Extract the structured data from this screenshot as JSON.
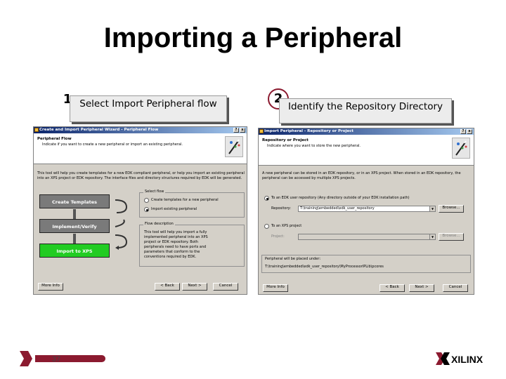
{
  "slide": {
    "title": "Importing a Peripheral",
    "page_number": "37",
    "logo_text": "XILINX",
    "brand_color": "#8b1a2f"
  },
  "steps": [
    {
      "number": "1",
      "label": "Select Import Peripheral flow"
    },
    {
      "number": "2",
      "label": "Identify the Repository Directory"
    }
  ],
  "window1": {
    "title": "Create and Import Peripheral Wizard - Peripheral Flow",
    "help_btn": "?",
    "close_btn": "x",
    "header_title": "Peripheral Flow",
    "header_subtitle": "Indicate if you want to create a new peripheral or import an existing peripheral.",
    "intro": "This tool will help you create templates for a new EDK compliant peripheral, or help you import an existing peripheral into an XPS project or EDK repository. The interface files and directory structures required by EDK will be generated.",
    "flow_boxes": [
      "Create Templates",
      "Implement/Verify",
      "Import to XPS"
    ],
    "select_flow_legend": "Select flow",
    "option_create": "Create templates for a new peripheral",
    "option_import": "Import existing peripheral",
    "flow_desc_legend": "Flow description",
    "flow_description": "This tool will help you import a fully implemented peripheral into an XPS project or EDK repository. Both peripherals need to have ports and parameters that conform to the conventions required by EDK.",
    "buttons": {
      "more_info": "More Info",
      "back": "< Back",
      "next": "Next >",
      "cancel": "Cancel"
    }
  },
  "window2": {
    "title": "Import Peripheral - Repository or Project",
    "help_btn": "?",
    "close_btn": "x",
    "header_title": "Repository or Project",
    "header_subtitle": "Indicate where you want to store the new peripheral.",
    "intro": "A new peripheral can be stored in an EDK repository, or in an XPS project. When stored in an EDK repository, the peripheral can be accessed by multiple XPS projects.",
    "option_repo": "To an EDK user repository (Any directory outside of your EDK installation path)",
    "repository_label": "Repository:",
    "repository_value": "T:\\training\\embedded\\edk_user_repository",
    "browse_label": "Browse...",
    "option_project": "To an XPS project",
    "project_label": "Project:",
    "project_value": "",
    "stored_label": "Peripheral will be placed under:",
    "stored_path": "T:\\training\\embedded\\edk_user_repository\\MyProcessorIPLib\\pcores",
    "buttons": {
      "more_info": "More Info",
      "back": "< Back",
      "next": "Next >",
      "cancel": "Cancel"
    }
  }
}
